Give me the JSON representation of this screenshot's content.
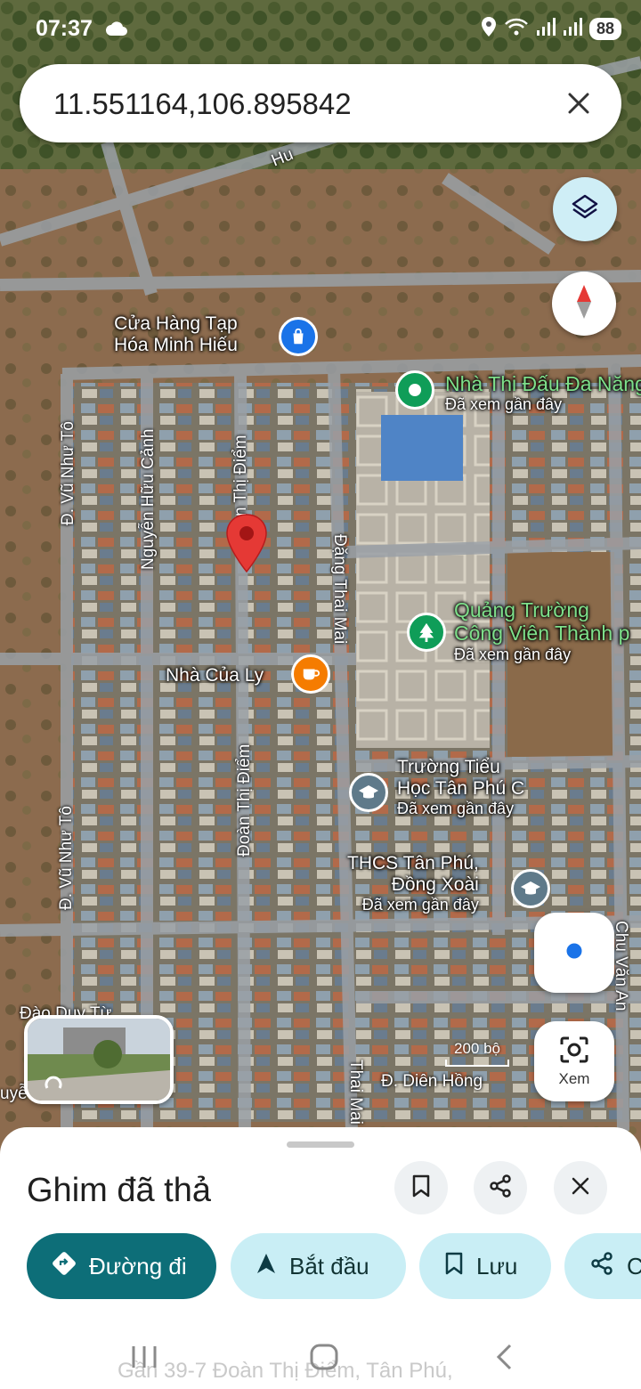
{
  "status": {
    "time": "07:37",
    "battery": "88",
    "icons": [
      "cloud-icon",
      "location-icon",
      "wifi-icon",
      "signal-icon",
      "signal-icon"
    ]
  },
  "search": {
    "value": "11.551164,106.895842",
    "clear_icon": "close-icon"
  },
  "map": {
    "places": [
      {
        "name_line1": "Cửa Hàng Tạp",
        "name_line2": "Hóa Minh Hiếu",
        "icon": "shopping-bag-icon",
        "color": "#1a73e8"
      },
      {
        "name_line1": "Nhà Thi Đấu Đa Năng",
        "subtitle": "Đã xem gần đây",
        "icon": "pin-dot-icon",
        "color": "#0f9d58"
      },
      {
        "name_line1": "Quảng Trường",
        "name_line2": "Công Viên Thành p",
        "subtitle": "Đã xem gần đây",
        "icon": "tree-icon",
        "color": "#0f9d58"
      },
      {
        "name_line1": "Nhà Của Ly",
        "icon": "cafe-icon",
        "color": "#f57c00"
      },
      {
        "name_line1": "Trường Tiểu",
        "name_line2": "Học Tân Phú C",
        "subtitle": "Đã xem gần đây",
        "icon": "school-icon",
        "color": "#5f7a8a"
      },
      {
        "name_line1": "THCS Tân Phú,",
        "name_line2": "Đồng Xoài",
        "subtitle": "Đã xem gần đây",
        "icon": "school-icon",
        "color": "#5f7a8a"
      }
    ],
    "streets": [
      "Đ. Vũ Như Tô",
      "Nguyễn Hữu Cảnh",
      "n Thị Điểm",
      "Đặng Thai Mai",
      "Đoàn Thị Điểm",
      "Đ. Vũ Như Tô",
      "Chu Văn An",
      "Đào Duy Từ",
      "Đ. Diên Hồng",
      "Thai Mai",
      "Hu",
      "uyễ",
      "Q"
    ],
    "scale": "200 bộ"
  },
  "controls": {
    "layers_icon": "layers-icon",
    "compass_icon": "compass-icon",
    "location_icon": "my-location-icon",
    "lens_label": "Xem"
  },
  "sheet": {
    "title": "Ghim đã thả",
    "chips": {
      "directions": "Đường đi",
      "start": "Bắt đầu",
      "save": "Lưu",
      "share": "C"
    },
    "address": "Gần 39-7 Đoàn Thị Điểm, Tân Phú,"
  },
  "colors": {
    "primary_teal": "#0d6e78",
    "chip_bg": "#c9eef5",
    "pin_red": "#e53935"
  }
}
